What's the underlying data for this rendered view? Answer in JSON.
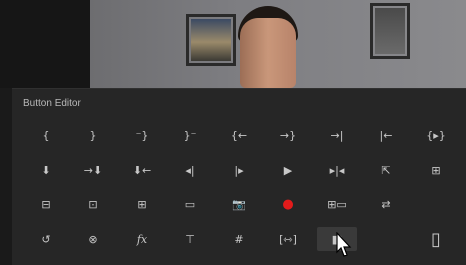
{
  "panel": {
    "title": "Button Editor"
  },
  "colors": {
    "record": "#e31b1b",
    "panel_bg": "#262626",
    "icon": "#c8c8c8"
  },
  "rows": [
    [
      {
        "name": "mark-in-icon",
        "glyph": "{"
      },
      {
        "name": "mark-out-icon",
        "glyph": "}"
      },
      {
        "name": "mark-clip-out-icon",
        "glyph": "⁻}"
      },
      {
        "name": "go-to-in-icon",
        "glyph": "}⁻"
      },
      {
        "name": "go-to-in-point-icon",
        "glyph": "{←"
      },
      {
        "name": "go-to-out-point-icon",
        "glyph": "→}"
      },
      {
        "name": "step-forward-edit-icon",
        "glyph": "→|"
      },
      {
        "name": "step-back-edit-icon",
        "glyph": "|←"
      },
      {
        "name": "play-in-to-out-icon",
        "glyph": "{▸}"
      }
    ],
    [
      {
        "name": "add-marker-icon",
        "glyph": "⬇"
      },
      {
        "name": "go-to-next-marker-icon",
        "glyph": "→⬇"
      },
      {
        "name": "go-to-previous-marker-icon",
        "glyph": "⬇←"
      },
      {
        "name": "step-back-icon",
        "glyph": "◂|"
      },
      {
        "name": "step-forward-icon",
        "glyph": "|▸"
      },
      {
        "name": "play-icon",
        "glyph": "▶"
      },
      {
        "name": "play-around-icon",
        "glyph": "▸|◂"
      },
      {
        "name": "lift-icon",
        "glyph": "⇱"
      },
      {
        "name": "extract-icon",
        "glyph": "⊞"
      }
    ],
    [
      {
        "name": "insert-icon",
        "glyph": "⊟"
      },
      {
        "name": "overwrite-icon",
        "glyph": "⊡"
      },
      {
        "name": "replace-icon",
        "glyph": "⊞"
      },
      {
        "name": "safe-margins-icon",
        "glyph": "▭"
      },
      {
        "name": "camera-icon",
        "glyph": "📷"
      },
      {
        "name": "record-icon",
        "glyph": "●",
        "color": "record"
      },
      {
        "name": "multi-camera-icon",
        "glyph": "⊞▭"
      },
      {
        "name": "toggle-proxy-icon",
        "glyph": "⇄"
      },
      {
        "name": "empty-slot-icon",
        "glyph": ""
      }
    ],
    [
      {
        "name": "loop-icon",
        "glyph": "↺"
      },
      {
        "name": "vr-video-icon",
        "glyph": "⊗"
      },
      {
        "name": "fx-icon",
        "glyph": "fx"
      },
      {
        "name": "timecode-icon",
        "glyph": "⊤"
      },
      {
        "name": "grid-icon",
        "glyph": "#"
      },
      {
        "name": "trim-icon",
        "glyph": "[⇿]"
      },
      {
        "name": "compare-view-icon",
        "glyph": "◧",
        "selected": true
      },
      {
        "name": "empty-slot-icon",
        "glyph": ""
      },
      {
        "name": "spacer-icon",
        "glyph": "▯"
      }
    ]
  ]
}
